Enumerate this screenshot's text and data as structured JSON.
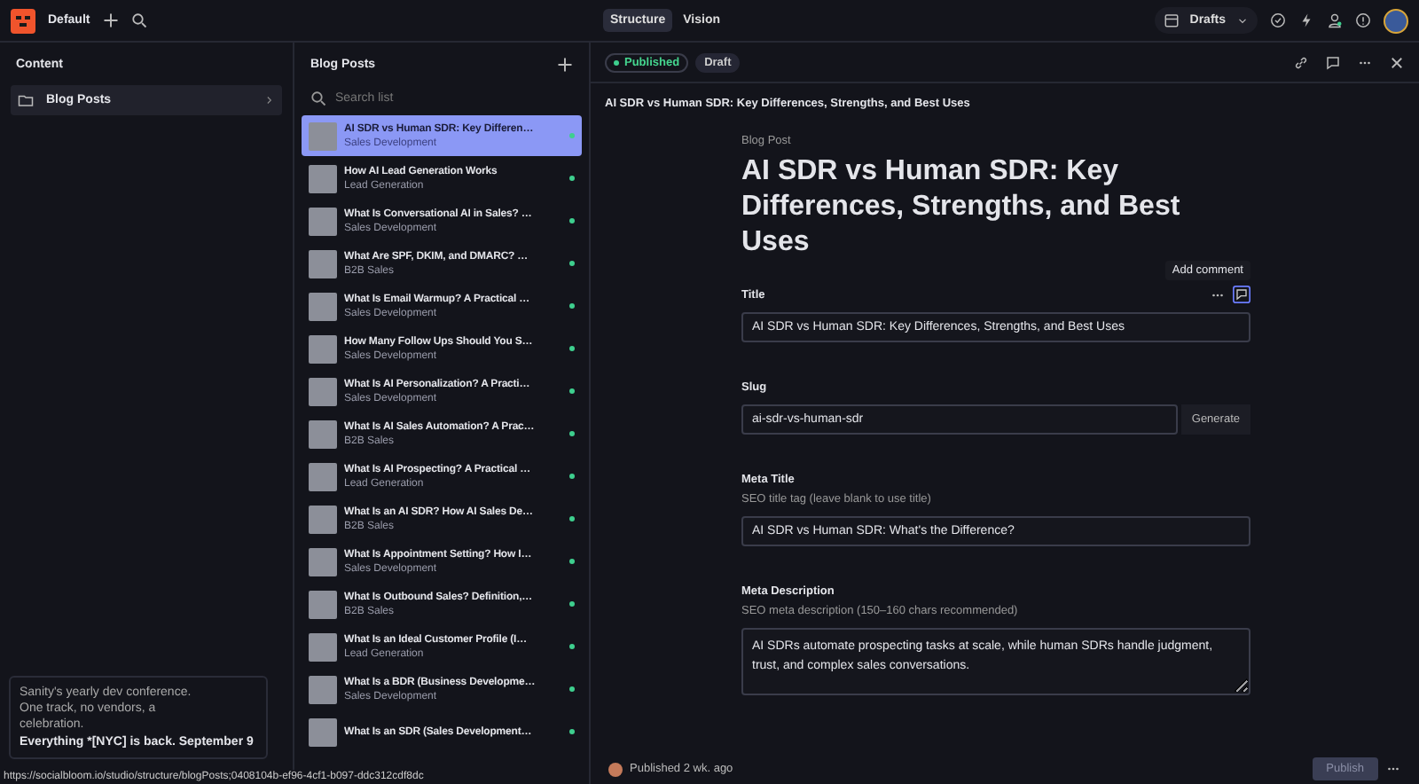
{
  "topbar": {
    "workspace": "Default",
    "modes": [
      {
        "label": "Structure",
        "selected": true
      },
      {
        "label": "Vision",
        "selected": false
      }
    ],
    "release": "Drafts"
  },
  "content_pane": {
    "title": "Content",
    "items": [
      {
        "label": "Blog Posts",
        "selected": true
      }
    ],
    "promo": {
      "text": "Sanity's yearly dev conference. One track, no vendors, a celebration.",
      "headline": "Everything *[NYC] is back. September 9"
    }
  },
  "list_pane": {
    "title": "Blog Posts",
    "search": {
      "placeholder": "Search list"
    },
    "items": [
      {
        "title": "AI SDR vs Human SDR: Key Differen…",
        "subtitle": "Sales Development",
        "selected": true,
        "published": true
      },
      {
        "title": "How AI Lead Generation Works",
        "subtitle": "Lead Generation",
        "selected": false,
        "published": true
      },
      {
        "title": "What Is Conversational AI in Sales? …",
        "subtitle": "Sales Development",
        "selected": false,
        "published": true
      },
      {
        "title": "What Are SPF, DKIM, and DMARC? …",
        "subtitle": "B2B Sales",
        "selected": false,
        "published": true
      },
      {
        "title": "What Is Email Warmup? A Practical …",
        "subtitle": "Sales Development",
        "selected": false,
        "published": true
      },
      {
        "title": "How Many Follow Ups Should You S…",
        "subtitle": "Sales Development",
        "selected": false,
        "published": true
      },
      {
        "title": "What Is AI Personalization? A Practi…",
        "subtitle": "Sales Development",
        "selected": false,
        "published": true
      },
      {
        "title": "What Is AI Sales Automation? A Prac…",
        "subtitle": "B2B Sales",
        "selected": false,
        "published": true
      },
      {
        "title": "What Is AI Prospecting? A Practical …",
        "subtitle": "Lead Generation",
        "selected": false,
        "published": true
      },
      {
        "title": "What Is an AI SDR? How AI Sales De…",
        "subtitle": "B2B Sales",
        "selected": false,
        "published": true
      },
      {
        "title": "What Is Appointment Setting? How I…",
        "subtitle": "Sales Development",
        "selected": false,
        "published": true
      },
      {
        "title": "What Is Outbound Sales? Definition,…",
        "subtitle": "B2B Sales",
        "selected": false,
        "published": true
      },
      {
        "title": "What Is an Ideal Customer Profile (I…",
        "subtitle": "Lead Generation",
        "selected": false,
        "published": true
      },
      {
        "title": "What Is a BDR (Business Developme…",
        "subtitle": "Sales Development",
        "selected": false,
        "published": true
      },
      {
        "title": "What Is an SDR (Sales Development…",
        "selected": false,
        "published": true
      }
    ]
  },
  "editor": {
    "versions": [
      {
        "label": "Published",
        "selected": true,
        "kind": "published"
      },
      {
        "label": "Draft",
        "selected": false,
        "kind": "draft"
      }
    ],
    "breadcrumb": "AI SDR vs Human SDR: Key Differences, Strengths, and Best Uses",
    "doc_type": "Blog Post",
    "heading": "AI SDR vs Human SDR: Key Differences, Strengths, and Best Uses",
    "tooltip": "Add comment",
    "fields": [
      {
        "kind": "text",
        "label": "Title",
        "value": "AI SDR vs Human SDR: Key Differences, Strengths, and Best Uses"
      },
      {
        "kind": "slug",
        "label": "Slug",
        "value": "ai-sdr-vs-human-sdr",
        "button": "Generate"
      },
      {
        "kind": "text",
        "label": "Meta Title",
        "hint": "SEO title tag (leave blank to use title)",
        "value": "AI SDR vs Human SDR: What's the Difference?"
      },
      {
        "kind": "textarea",
        "label": "Meta Description",
        "hint": "SEO meta description (150–160 chars recommended)",
        "value": "AI SDRs automate prospecting tasks at scale, while human SDRs handle judgment, trust, and complex sales conversations."
      }
    ],
    "footer": {
      "status": "Published 2 wk. ago",
      "publish": {
        "label": "Publish",
        "disabled": true
      }
    }
  },
  "status_url": "https://socialbloom.io/studio/structure/blogPosts;0408104b-ef96-4cf1-b097-ddc312cdf8dc"
}
